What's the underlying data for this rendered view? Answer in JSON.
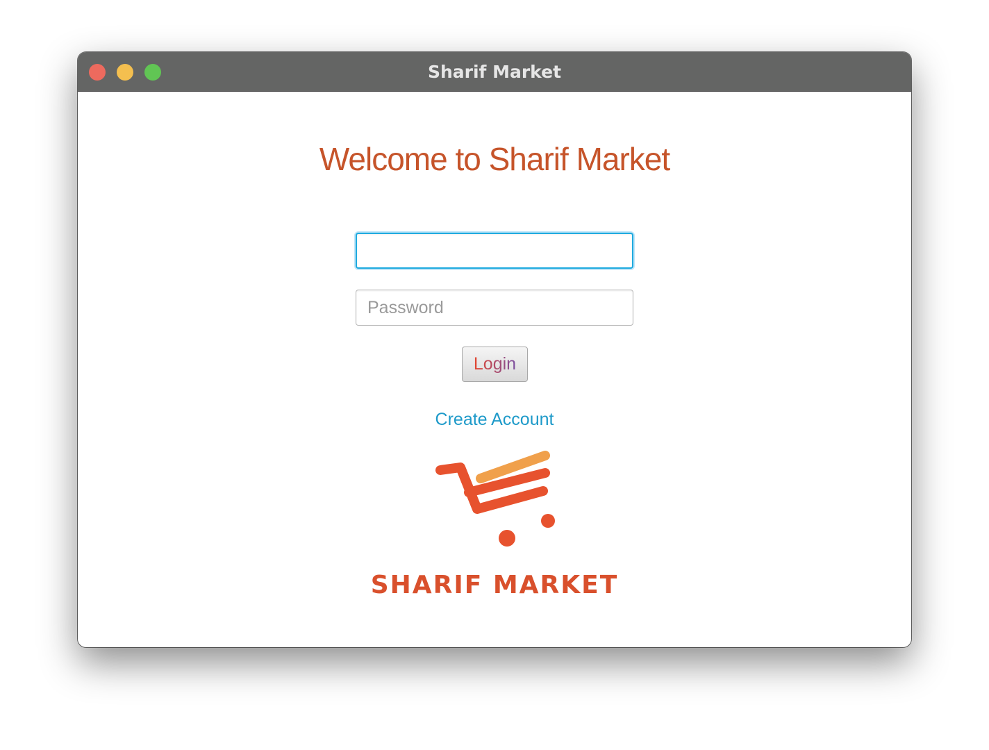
{
  "window": {
    "title": "Sharif Market"
  },
  "login": {
    "heading": "Welcome to Sharif Market",
    "username_value": "",
    "password_placeholder": "Password",
    "login_label": "Login",
    "create_account_label": "Create Account"
  },
  "logo": {
    "icon": "shopping-cart-icon",
    "brand_text": "SHARIF MARKET"
  },
  "colors": {
    "accent": "#c6542a",
    "link": "#1e9ac9",
    "focus": "#1eaadf",
    "titlebar": "#646564"
  }
}
